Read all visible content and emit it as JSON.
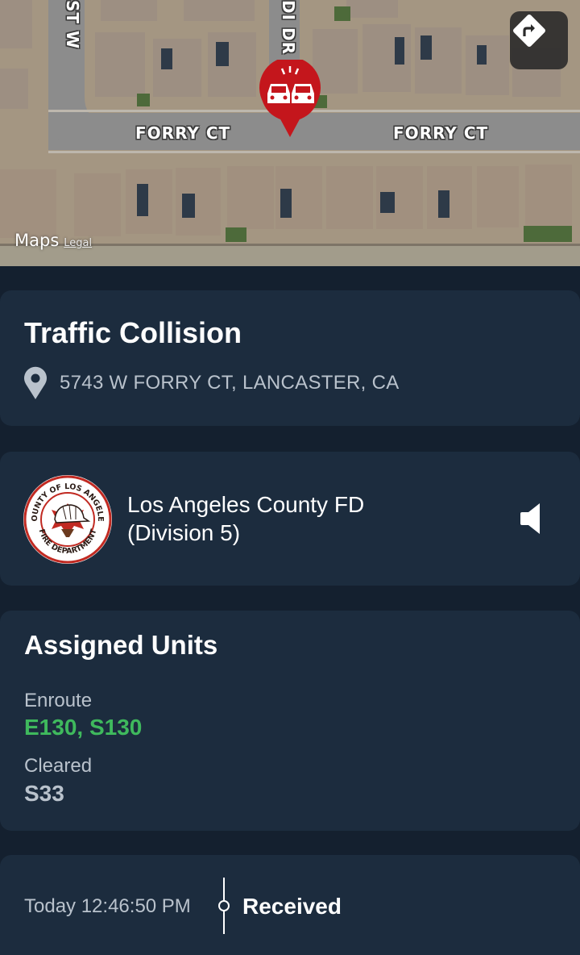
{
  "map": {
    "street_labels": [
      "FORRY CT",
      "FORRY CT",
      "ST W",
      "DI DR"
    ],
    "brand": "Maps",
    "legal_link": "Legal",
    "directions_icon": "directions-arrow-icon",
    "pin_icon": "traffic-collision-pin-icon",
    "pin_color": "#c4161c"
  },
  "incident": {
    "title": "Traffic Collision",
    "address": "5743 W FORRY CT, LANCASTER, CA",
    "location_icon": "location-pin-icon"
  },
  "agency": {
    "logo_text_top": "COUNTY OF LOS ANGELES",
    "logo_text_bottom": "FIRE DEPARTMENT",
    "name_line1": "Los Angeles County FD",
    "name_line2": "(Division 5)",
    "audio_icon": "speaker-icon"
  },
  "units": {
    "title": "Assigned Units",
    "enroute_label": "Enroute",
    "enroute_value": "E130, S130",
    "cleared_label": "Cleared",
    "cleared_value": "S33",
    "enroute_color": "#3fb95d"
  },
  "timeline": {
    "time": "Today 12:46:50 PM",
    "status": "Received"
  },
  "colors": {
    "background": "#14202f",
    "card": "#1c2c3e",
    "muted_text": "#b9c2cc"
  }
}
